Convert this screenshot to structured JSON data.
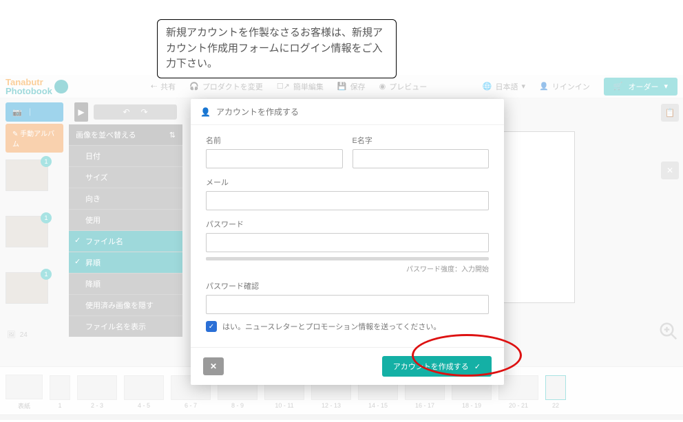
{
  "callout": "新規アカウントを作製なさるお客様は、新規アカウント作成用フォームにログイン情報をご入力下さい。",
  "brand": {
    "line1": "Tanabutr",
    "line2": "Photobook"
  },
  "topbar": {
    "share": "共有",
    "product": "プロダクトを変更",
    "edit": "簡単編集",
    "save": "保存",
    "preview": "プレビュー",
    "lang": "日本語",
    "login": "リインイン",
    "order": "オーダー"
  },
  "leftcol": {
    "badge1": "1",
    "badge2": "1",
    "badge3": "1",
    "album": "手動アルバム",
    "count": "24"
  },
  "sort": {
    "header": "画像を並べ替える",
    "items": [
      "日付",
      "サイズ",
      "向き",
      "使用",
      "ファイル名",
      "昇順",
      "降順",
      "使用済み画像を隠す",
      "ファイル名を表示"
    ]
  },
  "filmstrip": {
    "labels": [
      "表紙",
      "1",
      "2 - 3",
      "4 - 5",
      "6 - 7",
      "8 - 9",
      "10 - 11",
      "12 - 13",
      "14 - 15",
      "16 - 17",
      "18 - 19",
      "20 - 21",
      "22"
    ]
  },
  "modal": {
    "title": "アカウントを作成する",
    "name": "名前",
    "surname": "E名字",
    "email": "メール",
    "password": "パスワード",
    "pwhint": "パスワード強度：入力開始",
    "confirm": "パスワード確認",
    "newsletter": "はい。ニュースレターとプロモーション情報を送ってください。",
    "submit": "アカウントを作成する"
  }
}
